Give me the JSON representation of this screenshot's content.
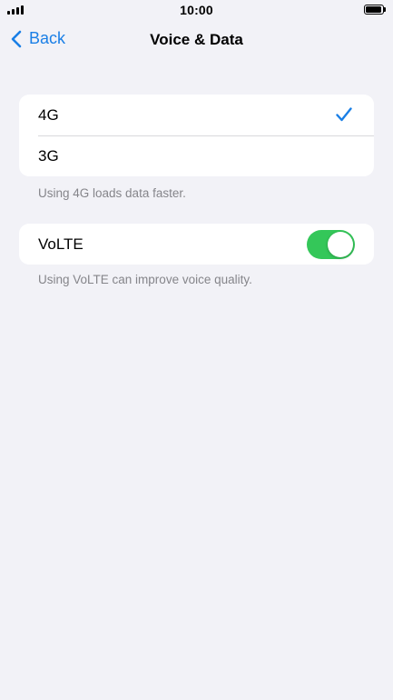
{
  "status_bar": {
    "time": "10:00"
  },
  "nav": {
    "back_label": "Back",
    "title": "Voice & Data"
  },
  "network_mode": {
    "options": [
      {
        "label": "4G",
        "selected": true
      },
      {
        "label": "3G",
        "selected": false
      }
    ],
    "footer": "Using 4G loads data faster."
  },
  "volte": {
    "label": "VoLTE",
    "enabled": true,
    "footer": "Using VoLTE can improve voice quality."
  },
  "colors": {
    "accent": "#1a7fe6",
    "toggle_on": "#34c759",
    "background": "#f2f2f7"
  },
  "icons": {
    "back": "chevron-left-icon",
    "check": "checkmark-icon",
    "signal": "cellular-signal-icon",
    "battery": "battery-icon"
  }
}
